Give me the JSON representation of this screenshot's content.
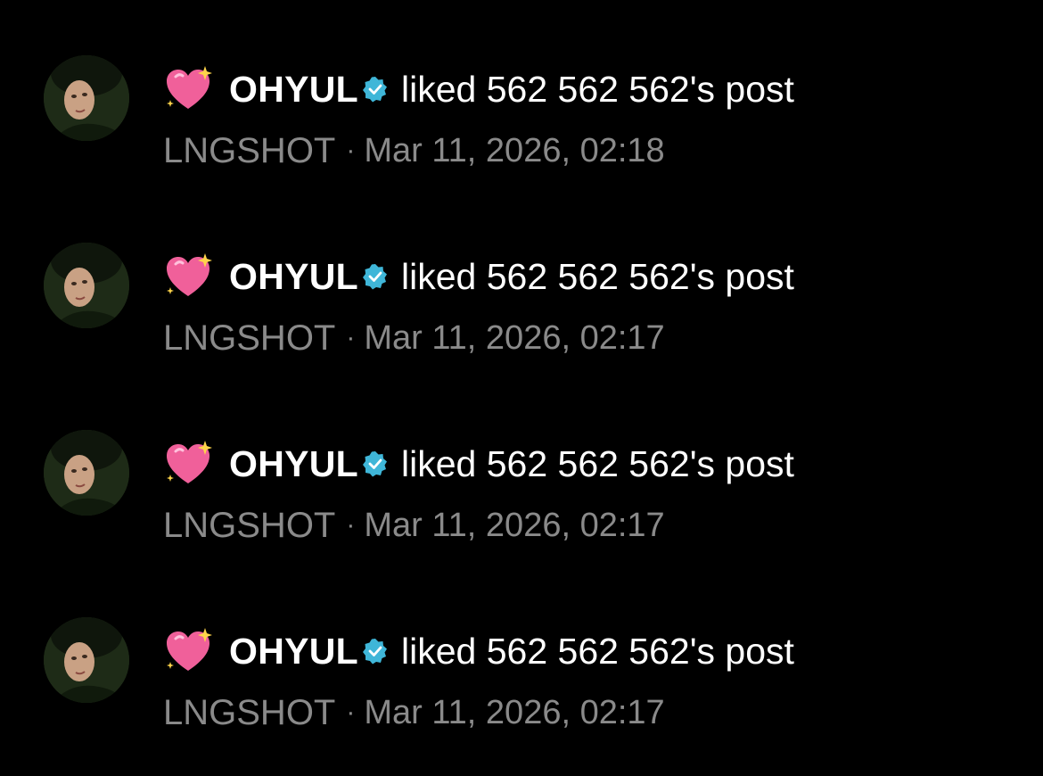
{
  "notifications": [
    {
      "emoji": "sparkling-heart-icon",
      "username": "OHYUL",
      "action": "liked 562 562 562's post",
      "group": "LNGSHOT",
      "separator": "·",
      "timestamp": "Mar 11, 2026, 02:18"
    },
    {
      "emoji": "sparkling-heart-icon",
      "username": "OHYUL",
      "action": "liked 562 562 562's post",
      "group": "LNGSHOT",
      "separator": "·",
      "timestamp": "Mar 11, 2026, 02:17"
    },
    {
      "emoji": "sparkling-heart-icon",
      "username": "OHYUL",
      "action": "liked 562 562 562's post",
      "group": "LNGSHOT",
      "separator": "·",
      "timestamp": "Mar 11, 2026, 02:17"
    },
    {
      "emoji": "sparkling-heart-icon",
      "username": "OHYUL",
      "action": "liked 562 562 562's post",
      "group": "LNGSHOT",
      "separator": "·",
      "timestamp": "Mar 11, 2026, 02:17"
    }
  ],
  "colors": {
    "background": "#000000",
    "primary_text": "#ffffff",
    "secondary_text": "#8a8a8a",
    "verified_badge": "#3fb6d8",
    "heart_pink": "#f0609a"
  }
}
